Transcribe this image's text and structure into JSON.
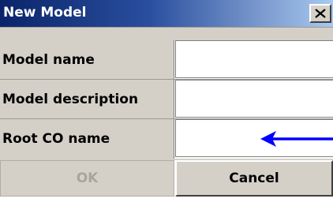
{
  "window": {
    "title": "New Model",
    "close_icon": "close-x-icon"
  },
  "form": {
    "fields": [
      {
        "label": "Model name",
        "value": ""
      },
      {
        "label": "Model description",
        "value": ""
      },
      {
        "label": "Root CO name",
        "value": ""
      }
    ]
  },
  "buttons": {
    "ok_label": "OK",
    "ok_enabled": false,
    "cancel_label": "Cancel"
  },
  "annotation": {
    "icon": "left-arrow-icon",
    "color": "#0000ff"
  },
  "colors": {
    "title_gradient_start": "#0a246a",
    "title_gradient_end": "#a6caf0",
    "dialog_face": "#d4d0c8"
  }
}
